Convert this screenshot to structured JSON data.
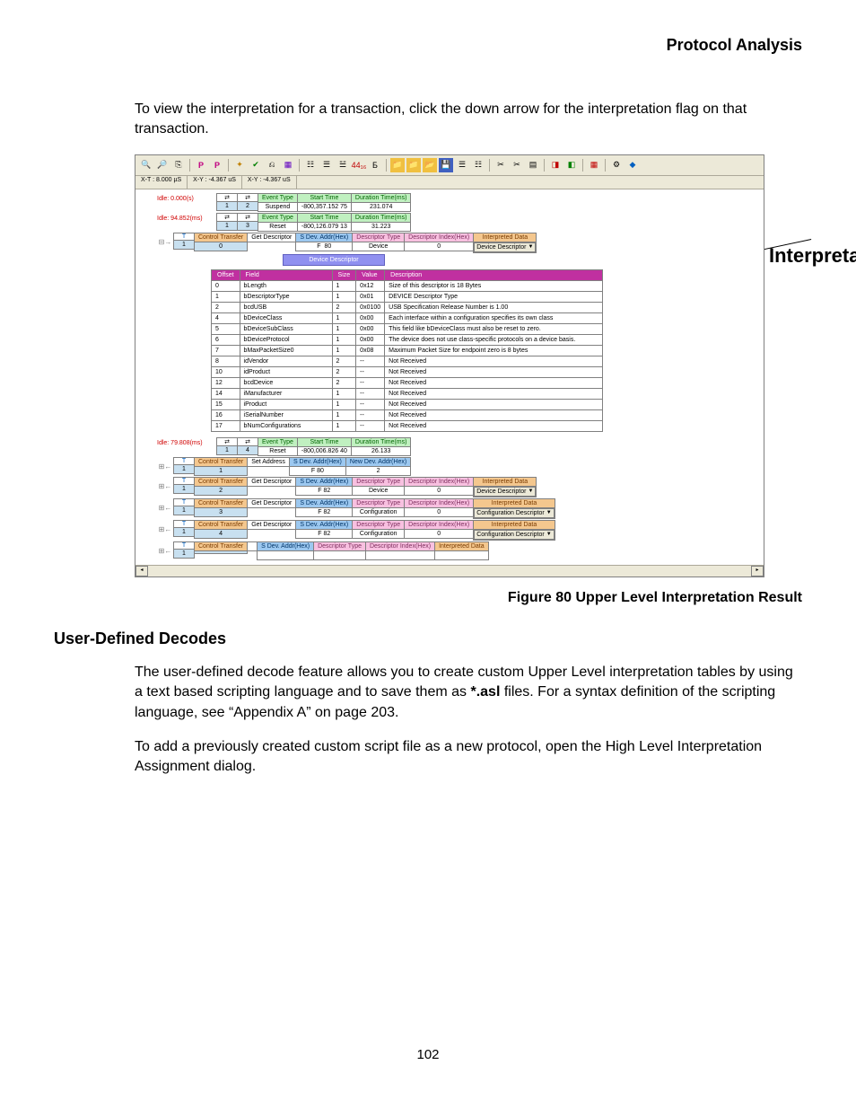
{
  "header": "Protocol Analysis",
  "intro": "To view the interpretation for a transaction, click the down arrow for the interpretation flag on that transaction.",
  "callout": "Interpretation flag",
  "figure_caption": "Figure  80  Upper Level Interpretation Result",
  "section_heading": "User-Defined Decodes",
  "para1_a": "The user-defined decode feature allows you to create custom Upper Level interpretation tables by using a text based scripting language and to save them as ",
  "para1_bold": "*.asl",
  "para1_b": " files. For a syntax definition of the scripting language, see “Appendix A” on page 203.",
  "para2": "To add a previously created custom script file as a new protocol, open the High Level Interpretation Assignment dialog.",
  "page_number": "102",
  "status": {
    "a": "X-T : 8.000 µS",
    "b": "X-Y : -4.367 uS",
    "c": "X-Y : -4.367 uS"
  },
  "labels": {
    "event_type": "Event Type",
    "start_time": "Start Time",
    "duration": "Duration Time(ms)",
    "control_transfer": "Control Transfer",
    "dev_addr": "S Dev. Addr(Hex)",
    "descriptor_type": "Descriptor Type",
    "descriptor_index": "Descriptor Index(Hex)",
    "interpreted_data": "Interpreted Data",
    "new_dev_addr": "New Dev. Addr(Hex)",
    "suspend": "Suspend",
    "reset": "Reset",
    "get_descriptor": "Get Descriptor",
    "set_address": "Set Address",
    "device": "Device",
    "configuration": "Configuration",
    "device_descriptor": "Device Descriptor",
    "config_descriptor": "Configuration Descriptor",
    "f": "F"
  },
  "events": [
    {
      "idle": "Idle: 0.000(s)",
      "n1": "1",
      "n2": "2",
      "type": "Suspend",
      "start": "-800,357.152 75",
      "dur": "231.074"
    },
    {
      "idle": "Idle: 94.852(ms)",
      "n1": "1",
      "n2": "3",
      "type": "Reset",
      "start": "-800,126.079 13",
      "dur": "31.223"
    }
  ],
  "ctrl0": {
    "n1": "1",
    "n2": "0",
    "op": "Get Descriptor",
    "addr": "80",
    "dtype": "Device",
    "didx": "0",
    "dd": "Device Descriptor"
  },
  "desc_bar": "Device Descriptor",
  "descriptor": {
    "headers": [
      "Offset",
      "Field",
      "Size",
      "Value",
      "Description"
    ],
    "rows": [
      [
        "0",
        "bLength",
        "1",
        "0x12",
        "Size of this descriptor is 18 Bytes"
      ],
      [
        "1",
        "bDescriptorType",
        "1",
        "0x01",
        "DEVICE Descriptor Type"
      ],
      [
        "2",
        "bcdUSB",
        "2",
        "0x0100",
        "USB Specification Release Number is 1.00"
      ],
      [
        "4",
        "bDeviceClass",
        "1",
        "0x00",
        "Each interface within a configuration specifies its own class"
      ],
      [
        "5",
        "bDeviceSubClass",
        "1",
        "0x00",
        "This field like bDeviceClass must also be reset to zero."
      ],
      [
        "6",
        "bDeviceProtocol",
        "1",
        "0x00",
        "The device does not use class-specific protocols on a device basis."
      ],
      [
        "7",
        "bMaxPacketSize0",
        "1",
        "0x08",
        "Maximum Packet Size for endpoint zero is 8 bytes"
      ],
      [
        "8",
        "idVendor",
        "2",
        "--",
        "Not Received"
      ],
      [
        "10",
        "idProduct",
        "2",
        "--",
        "Not Received"
      ],
      [
        "12",
        "bcdDevice",
        "2",
        "--",
        "Not Received"
      ],
      [
        "14",
        "iManufacturer",
        "1",
        "--",
        "Not Received"
      ],
      [
        "15",
        "iProduct",
        "1",
        "--",
        "Not Received"
      ],
      [
        "16",
        "iSerialNumber",
        "1",
        "--",
        "Not Received"
      ],
      [
        "17",
        "bNumConfigurations",
        "1",
        "--",
        "Not Received"
      ]
    ]
  },
  "event2": {
    "idle": "Idle: 79.808(ms)",
    "n1": "1",
    "n2": "4",
    "type": "Reset",
    "start": "-800,006.826 40",
    "dur": "26.133"
  },
  "ctrls": [
    {
      "n1": "1",
      "n2": "1",
      "op": "Set Address",
      "addr": "80",
      "new_addr": "2"
    },
    {
      "n1": "1",
      "n2": "2",
      "op": "Get Descriptor",
      "addr": "82",
      "dtype": "Device",
      "didx": "0",
      "dd": "Device Descriptor"
    },
    {
      "n1": "1",
      "n2": "3",
      "op": "Get Descriptor",
      "addr": "82",
      "dtype": "Configuration",
      "didx": "0",
      "dd": "Configuration Descriptor"
    },
    {
      "n1": "1",
      "n2": "4",
      "op": "Get Descriptor",
      "addr": "82",
      "dtype": "Configuration",
      "didx": "0",
      "dd": "Configuration Descriptor"
    },
    {
      "n1": "1",
      "n2": "",
      "op": "",
      "addr": "",
      "dtype": "",
      "didx": "",
      "dd": ""
    }
  ]
}
